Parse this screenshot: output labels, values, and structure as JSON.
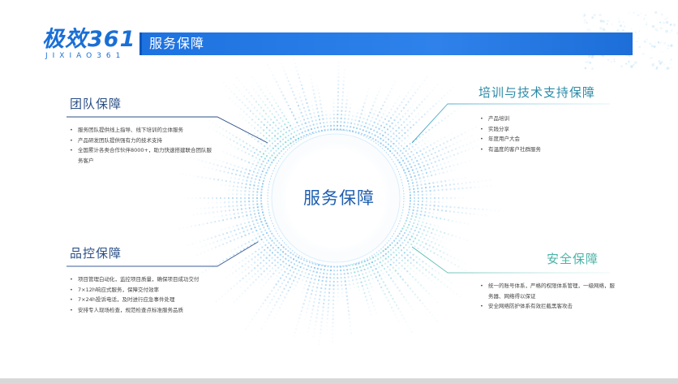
{
  "header": {
    "logo_main": "极效361",
    "logo_sub": "JIXIAO361",
    "title": "服务保障"
  },
  "center": {
    "title": "服务保障"
  },
  "sections": {
    "team": {
      "title": "团队保障",
      "items": [
        "服务团队提供线上指导、线下培训的立体服务",
        "产品研发团队提供强有力的技术支持",
        "全国累计各类合作伙伴8000+，助力快速搭建联合团队服务客户"
      ]
    },
    "quality": {
      "title": "品控保障",
      "items": [
        "项目管理白动化，监控项目质量，确保项目成功交付",
        "7×12h响应式服务，保障交付效率",
        "7×24h投诉电话，及时进行应急事件处理",
        "安排专人现场检查，规范检查点标准服务品质"
      ]
    },
    "training": {
      "title": "培训与技术支持保障",
      "items": [
        "产品培训",
        "实践分享",
        "年度用户大会",
        "有温度的客户社群服务"
      ]
    },
    "security": {
      "title": "安全保障",
      "items": [
        "统一的账号体系，严格的权限体系管理，一级网络，服务器、网络得以保证",
        "安全网络防护体系有效拦截黑客攻击"
      ]
    }
  },
  "colors": {
    "brand_blue": "#1d72e0",
    "team_line": "#2b4f86",
    "training_line": "#2c9ac0",
    "security_line": "#48b3a6",
    "ring_blue": "#5aaee8",
    "ring_teal": "#4cc4c6"
  }
}
